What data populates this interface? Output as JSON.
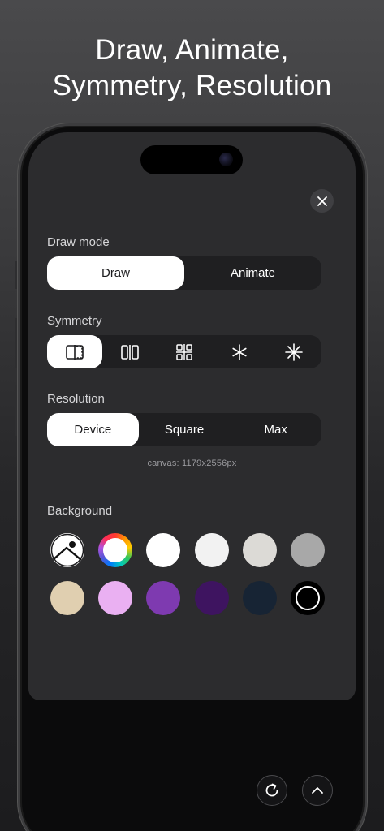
{
  "headline": {
    "line1": "Draw, Animate,",
    "line2": "Symmetry, Resolution"
  },
  "panel": {
    "draw_mode": {
      "label": "Draw mode",
      "options": [
        "Draw",
        "Animate"
      ],
      "selected": "Draw"
    },
    "symmetry": {
      "label": "Symmetry",
      "options": [
        "mirror-vertical-icon",
        "mirror-double-icon",
        "quad-symmetry-icon",
        "radial-6-icon",
        "radial-8-icon"
      ],
      "selected": "mirror-vertical-icon"
    },
    "resolution": {
      "label": "Resolution",
      "options": [
        "Device",
        "Square",
        "Max"
      ],
      "selected": "Device",
      "canvas_info": "canvas: 1179x2556px"
    },
    "background": {
      "label": "Background",
      "swatches": [
        {
          "name": "image-picker",
          "color": "#ffffff"
        },
        {
          "name": "color-wheel",
          "color": "rainbow"
        },
        {
          "name": "white",
          "color": "#ffffff"
        },
        {
          "name": "off-white",
          "color": "#f2f2f2"
        },
        {
          "name": "light-gray",
          "color": "#dcdad6"
        },
        {
          "name": "gray",
          "color": "#a8a8a8"
        },
        {
          "name": "beige",
          "color": "#e0cfb0"
        },
        {
          "name": "lavender",
          "color": "#eab0f2"
        },
        {
          "name": "purple",
          "color": "#7e3ab0"
        },
        {
          "name": "dark-purple",
          "color": "#3e1460"
        },
        {
          "name": "navy",
          "color": "#172434"
        },
        {
          "name": "black",
          "color": "#000000"
        }
      ]
    }
  },
  "colors": {
    "panel": "#2c2c2e",
    "segment_bg": "#1f1f21",
    "active": "#ffffff"
  }
}
